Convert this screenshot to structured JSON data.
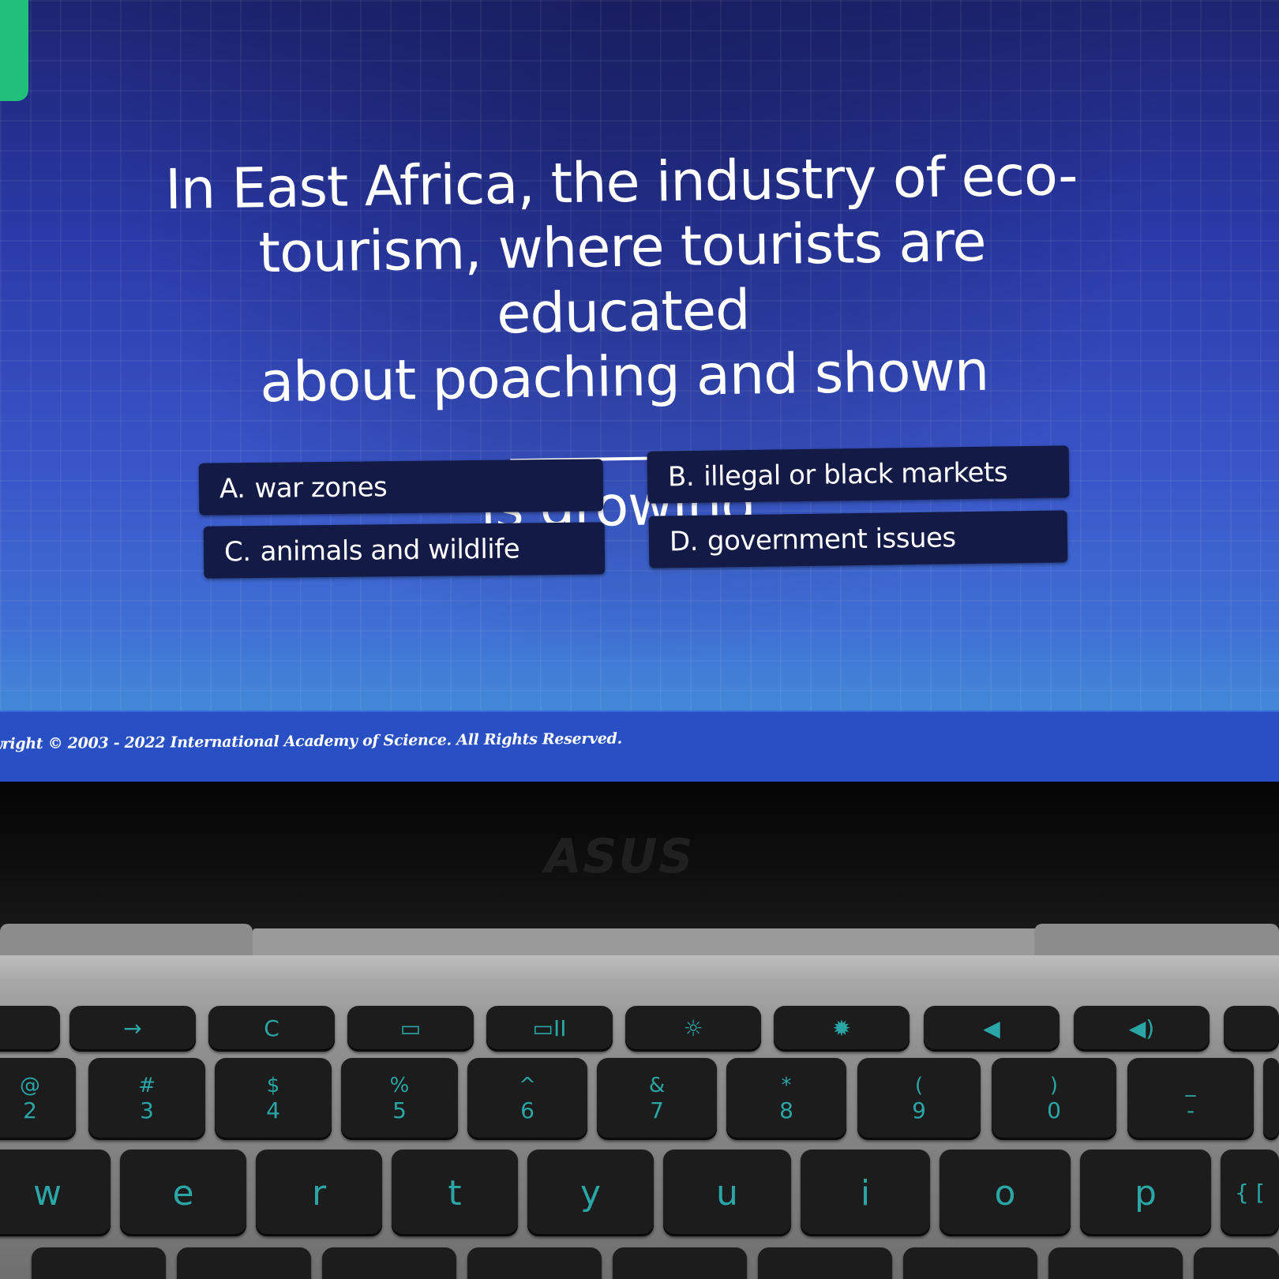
{
  "question": {
    "line1": "In East Africa, the industry of eco-",
    "line2": "tourism, where tourists are educated",
    "line3": "about poaching and shown",
    "line3_tail": ",",
    "line4": "is growing."
  },
  "answers": [
    {
      "letter": "A.",
      "text": "war zones"
    },
    {
      "letter": "B.",
      "text": "illegal or black markets"
    },
    {
      "letter": "C.",
      "text": "animals and wildlife"
    },
    {
      "letter": "D.",
      "text": "government issues"
    }
  ],
  "footer": {
    "copyright": "yright © 2003 - 2022 International Academy of Science.  All Rights Reserved."
  },
  "laptop": {
    "brand": "ASUS",
    "function_keys": [
      "→",
      "C",
      "▭",
      "▭II",
      "☼",
      "✹",
      "◀",
      "◀)"
    ],
    "number_keys": [
      {
        "top": "@",
        "bot": "2"
      },
      {
        "top": "#",
        "bot": "3"
      },
      {
        "top": "$",
        "bot": "4"
      },
      {
        "top": "%",
        "bot": "5"
      },
      {
        "top": "^",
        "bot": "6"
      },
      {
        "top": "&",
        "bot": "7"
      },
      {
        "top": "*",
        "bot": "8"
      },
      {
        "top": "(",
        "bot": "9"
      },
      {
        "top": ")",
        "bot": "0"
      },
      {
        "top": "_",
        "bot": "-"
      }
    ],
    "letter_keys": [
      "w",
      "e",
      "r",
      "t",
      "y",
      "u",
      "i",
      "o",
      "p",
      "{ ["
    ]
  },
  "colors": {
    "screen_top": "#1d2470",
    "screen_bottom": "#4387d8",
    "answer_bg": "#131a45",
    "badge": "#20c07a",
    "key_legend": "#2aa6a6"
  }
}
